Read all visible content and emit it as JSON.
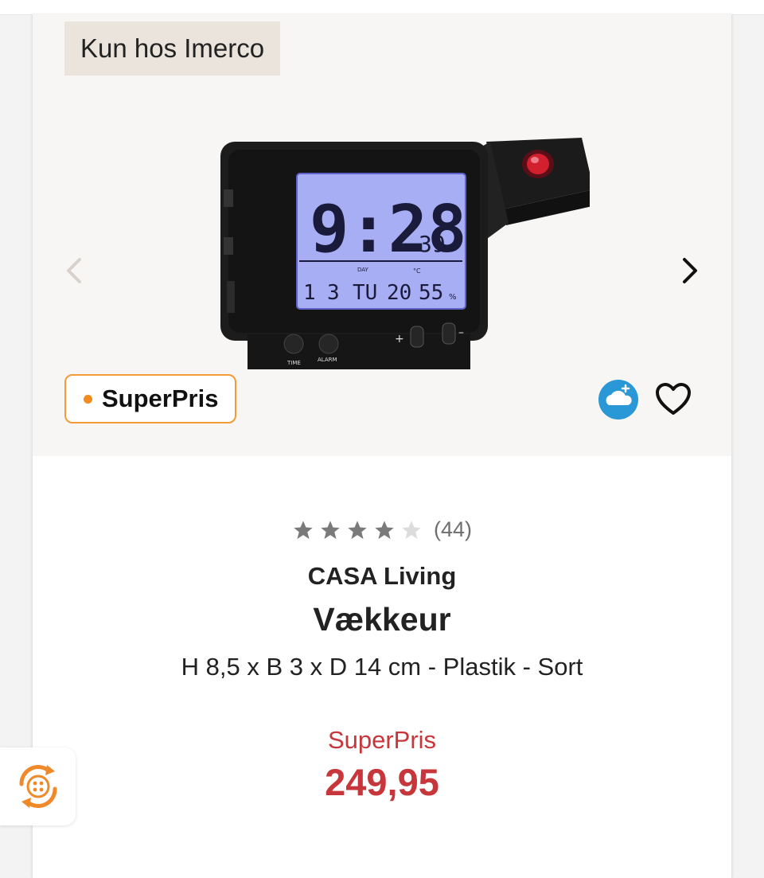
{
  "product": {
    "exclusive_badge": "Kun hos Imerco",
    "superpris_badge": "SuperPris",
    "rating": {
      "stars": 4,
      "max_stars": 5,
      "count": "(44)"
    },
    "brand": "CASA Living",
    "name": "Vækkeur",
    "description": "H 8,5 x B 3 x D 14 cm - Plastik - Sort",
    "price_label": "SuperPris",
    "price": "249,95"
  },
  "clock_display": {
    "time": "9:28",
    "seconds": "39",
    "date_day": "1",
    "date_month": "3",
    "weekday": "TU",
    "day_label": "DAY",
    "temperature": "20",
    "humidity": "55",
    "unit_c": "°C",
    "humidity_unit": "%",
    "button_time": "TIME",
    "button_alarm": "ALARM"
  },
  "icons": {
    "prev": "chevron-left-icon",
    "next": "chevron-right-icon",
    "cloud": "cloud-plus-icon",
    "wishlist": "heart-outline-icon",
    "widget": "loyalty-widget-icon"
  },
  "colors": {
    "accent_red": "#c7363a",
    "badge_orange": "#f29b37",
    "star_filled": "#7a7a7a",
    "star_empty": "#dcdcdc",
    "cloud_blue": "#2a97d6"
  }
}
